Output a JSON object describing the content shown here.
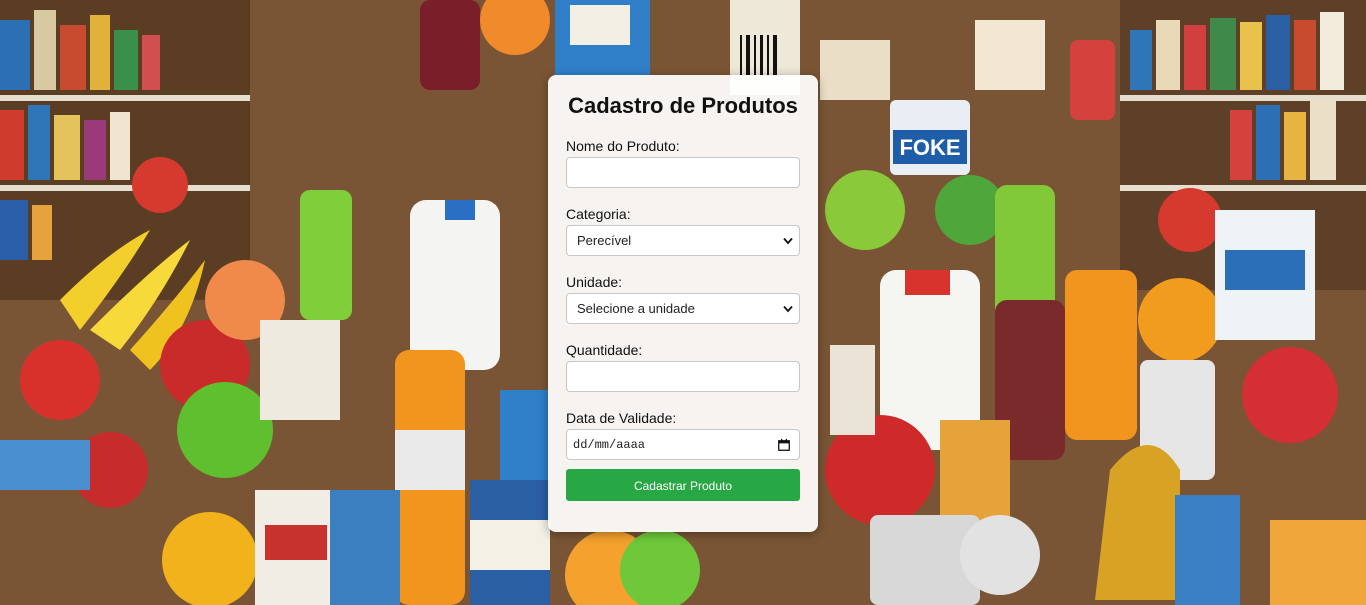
{
  "page": {
    "background_theme": "grocery-products-illustration"
  },
  "form": {
    "title": "Cadastro de Produtos",
    "fields": {
      "product_name": {
        "label": "Nome do Produto:",
        "value": ""
      },
      "category": {
        "label": "Categoria:",
        "selected": "Perecível"
      },
      "unit": {
        "label": "Unidade:",
        "selected": "Selecione a unidade"
      },
      "quantity": {
        "label": "Quantidade:",
        "value": ""
      },
      "expiry_date": {
        "label": "Data de Validade:",
        "placeholder": "dd/mm/aaaa"
      }
    },
    "submit_label": "Cadastrar Produto"
  },
  "colors": {
    "submit_button": "#28a745",
    "card_background": "#ffffff"
  },
  "icons": {
    "select_arrow": "chevron-down-icon",
    "date_picker": "calendar-icon"
  }
}
